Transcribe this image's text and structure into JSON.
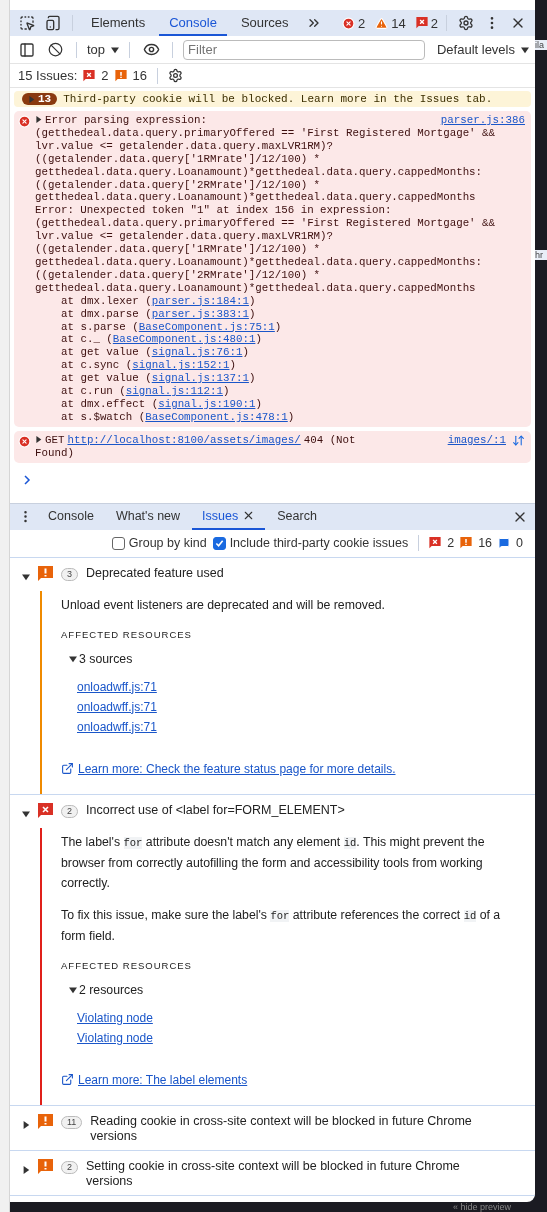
{
  "topbar": {
    "tabs": [
      {
        "label": "Elements",
        "selected": false
      },
      {
        "label": "Console",
        "selected": true
      },
      {
        "label": "Sources",
        "selected": false
      }
    ],
    "error_count": "2",
    "warning_count": "14",
    "issue_count": "2"
  },
  "console_toolbar": {
    "context": "top",
    "filter_placeholder": "Filter",
    "levels": "Default levels"
  },
  "issues_summary": {
    "label": "15 Issues:",
    "errors": "2",
    "warnings": "16"
  },
  "messages": [
    {
      "kind": "banner",
      "count": "13",
      "text": "Third-party cookie will be blocked. Learn more in the Issues tab."
    },
    {
      "kind": "exception",
      "expanded": false,
      "source": "parser.js:386",
      "lines": [
        "Error parsing expression:",
        "(getthedeal.data.query.primaryOffered == 'First Registered Mortgage' &&",
        "lvr.value <= getalender.data.query.maxLVR1RM)?",
        "((getalender.data.query['1RMrate']/12/100) *",
        "getthedeal.data.query.Loanamount)*getthedeal.data.query.cappedMonths:",
        "((getalender.data.query['2RMrate']/12/100) *",
        "getthedeal.data.query.Loanamount)*getthedeal.data.query.cappedMonths",
        "Error: Unexpected token \"1\" at index 156 in expression:",
        "(getthedeal.data.query.primaryOffered == 'First Registered Mortgage' &&",
        "lvr.value <= getalender.data.query.maxLVR1RM)?",
        "((getalender.data.query['1RMrate']/12/100) *",
        "getthedeal.data.query.Loanamount)*getthedeal.data.query.cappedMonths:",
        "((getalender.data.query['2RMrate']/12/100) *",
        "getthedeal.data.query.Loanamount)*getthedeal.data.query.cappedMonths"
      ],
      "stack": [
        {
          "at": "at dmx.lexer (",
          "link": "parser.js:184:1",
          "end": ")"
        },
        {
          "at": "at dmx.parse (",
          "link": "parser.js:383:1",
          "end": ")"
        },
        {
          "at": "at s.parse (",
          "link": "BaseComponent.js:75:1",
          "end": ")"
        },
        {
          "at": "at c._ (",
          "link": "BaseComponent.js:480:1",
          "end": ")"
        },
        {
          "at": "at get value (",
          "link": "signal.js:76:1",
          "end": ")"
        },
        {
          "at": "at c.sync (",
          "link": "signal.js:152:1",
          "end": ")"
        },
        {
          "at": "at get value (",
          "link": "signal.js:137:1",
          "end": ")"
        },
        {
          "at": "at c.run (",
          "link": "signal.js:112:1",
          "end": ")"
        },
        {
          "at": "at dmx.effect (",
          "link": "signal.js:190:1",
          "end": ")"
        },
        {
          "at": "at s.$watch (",
          "link": "BaseComponent.js:478:1",
          "end": ")"
        }
      ]
    },
    {
      "kind": "network",
      "expanded": false,
      "method": "GET",
      "url": "http://localhost:8100/assets/images/",
      "status": "404 (Not",
      "status_rest": "Found)",
      "source": "images/:1"
    }
  ],
  "drawer": {
    "tabs": [
      {
        "label": "Console",
        "selected": false,
        "closable": false
      },
      {
        "label": "What's new",
        "selected": false,
        "closable": false
      },
      {
        "label": "Issues",
        "selected": true,
        "closable": true
      },
      {
        "label": "Search",
        "selected": false,
        "closable": false
      }
    ],
    "filters": [
      {
        "label": "Group by kind",
        "checked": false
      },
      {
        "label": "Include third-party cookie issues",
        "checked": true
      }
    ],
    "errors": "2",
    "warnings": "16",
    "infos": "0"
  },
  "issues": [
    {
      "kind": "warning",
      "count": "3",
      "title": "Deprecated feature used",
      "expanded": true,
      "paragraphs": [
        [
          {
            "kind": "text",
            "text": "Unload event listeners are deprecated and will be removed."
          }
        ]
      ],
      "affected_heading": "AFFECTED RESOURCES",
      "resources_label": "3 sources",
      "resources": [
        "onloadwff.js:71",
        "onloadwff.js:71",
        "onloadwff.js:71"
      ],
      "learn_more": "Learn more: Check the feature status page for more details."
    },
    {
      "kind": "error",
      "count": "2",
      "title": "Incorrect use of <label for=FORM_ELEMENT>",
      "expanded": true,
      "paragraphs": [
        [
          {
            "kind": "text",
            "text": "The label's "
          },
          {
            "kind": "code",
            "text": "for"
          },
          {
            "kind": "text",
            "text": " attribute doesn't match any element "
          },
          {
            "kind": "code",
            "text": "id"
          },
          {
            "kind": "text",
            "text": ". This might prevent the browser from correctly autofilling the form and accessibility tools from working correctly."
          }
        ],
        [
          {
            "kind": "text",
            "text": "To fix this issue, make sure the label's "
          },
          {
            "kind": "code",
            "text": "for"
          },
          {
            "kind": "text",
            "text": " attribute references the correct "
          },
          {
            "kind": "code",
            "text": "id"
          },
          {
            "kind": "text",
            "text": " of a form field."
          }
        ]
      ],
      "affected_heading": "AFFECTED RESOURCES",
      "resources_label": "2 resources",
      "resources": [
        "Violating node",
        "Violating node"
      ],
      "learn_more": "Learn more: The label elements"
    },
    {
      "kind": "warning",
      "count": "11",
      "title": "Reading cookie in cross-site context will be blocked in future Chrome versions",
      "expanded": false
    },
    {
      "kind": "warning",
      "count": "2",
      "title": "Setting cookie in cross-site context will be blocked in future Chrome versions",
      "expanded": false
    }
  ],
  "background": {
    "fragments": [
      "ila",
      "hr"
    ],
    "footer": "« hide preview"
  }
}
